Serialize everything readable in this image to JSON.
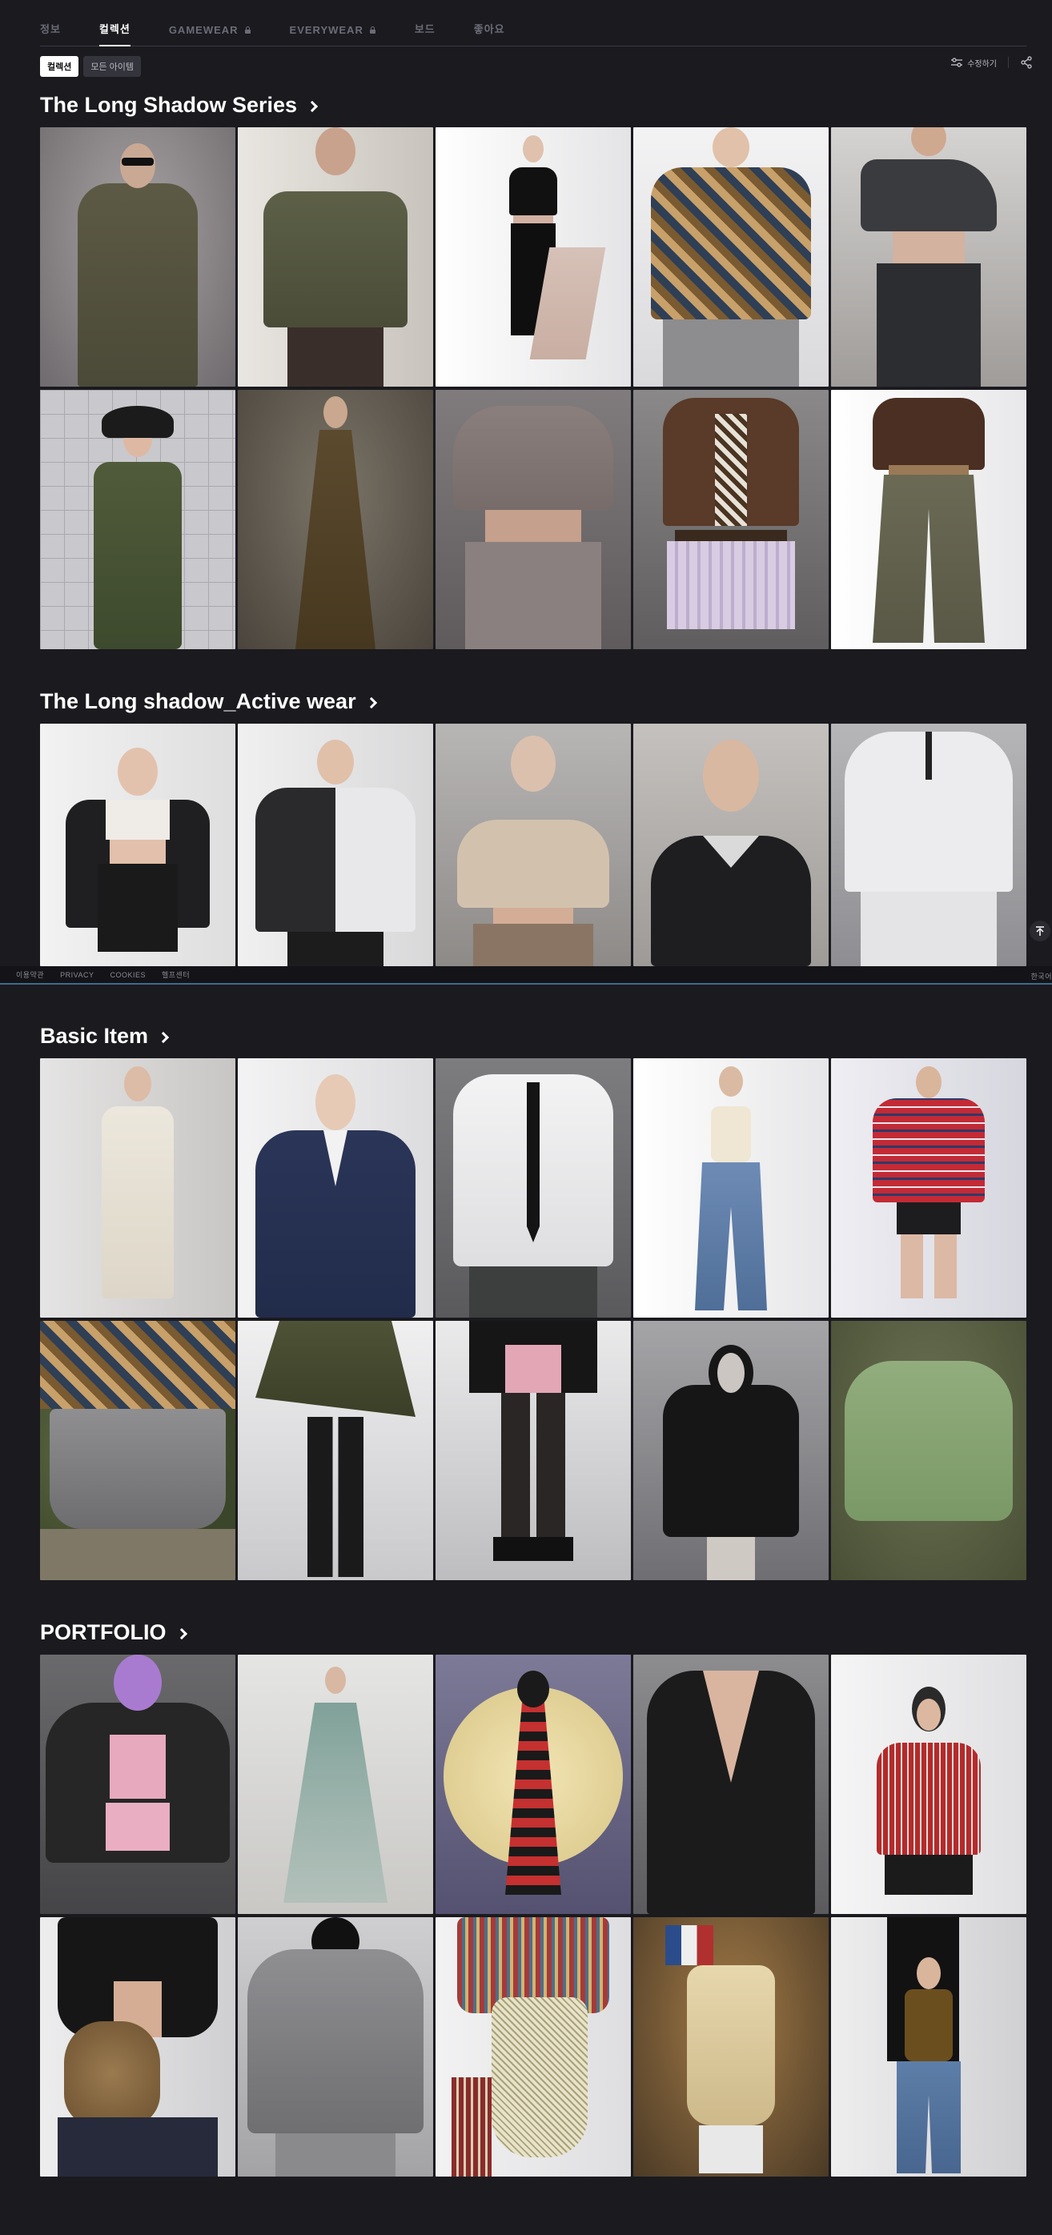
{
  "tabs": [
    {
      "label": "정보",
      "active": false,
      "locked": false
    },
    {
      "label": "컬렉션",
      "active": true,
      "locked": false
    },
    {
      "label": "GAMEWEAR",
      "active": false,
      "locked": true
    },
    {
      "label": "EVERYWEAR",
      "active": false,
      "locked": true
    },
    {
      "label": "보드",
      "active": false,
      "locked": false
    },
    {
      "label": "좋아요",
      "active": false,
      "locked": false
    }
  ],
  "filters": [
    {
      "label": "컬렉션",
      "active": true
    },
    {
      "label": "모든 아이템",
      "active": false
    }
  ],
  "toolbar": {
    "edit_label": "수정하기"
  },
  "sections": [
    {
      "title": "The Long Shadow Series"
    },
    {
      "title": "The Long shadow_Active wear"
    },
    {
      "title": "Basic Item"
    },
    {
      "title": "PORTFOLIO"
    }
  ],
  "footer": {
    "links": [
      "이용약관",
      "PRIVACY",
      "COOKIES",
      "헬프센터"
    ],
    "language": "한국어"
  }
}
